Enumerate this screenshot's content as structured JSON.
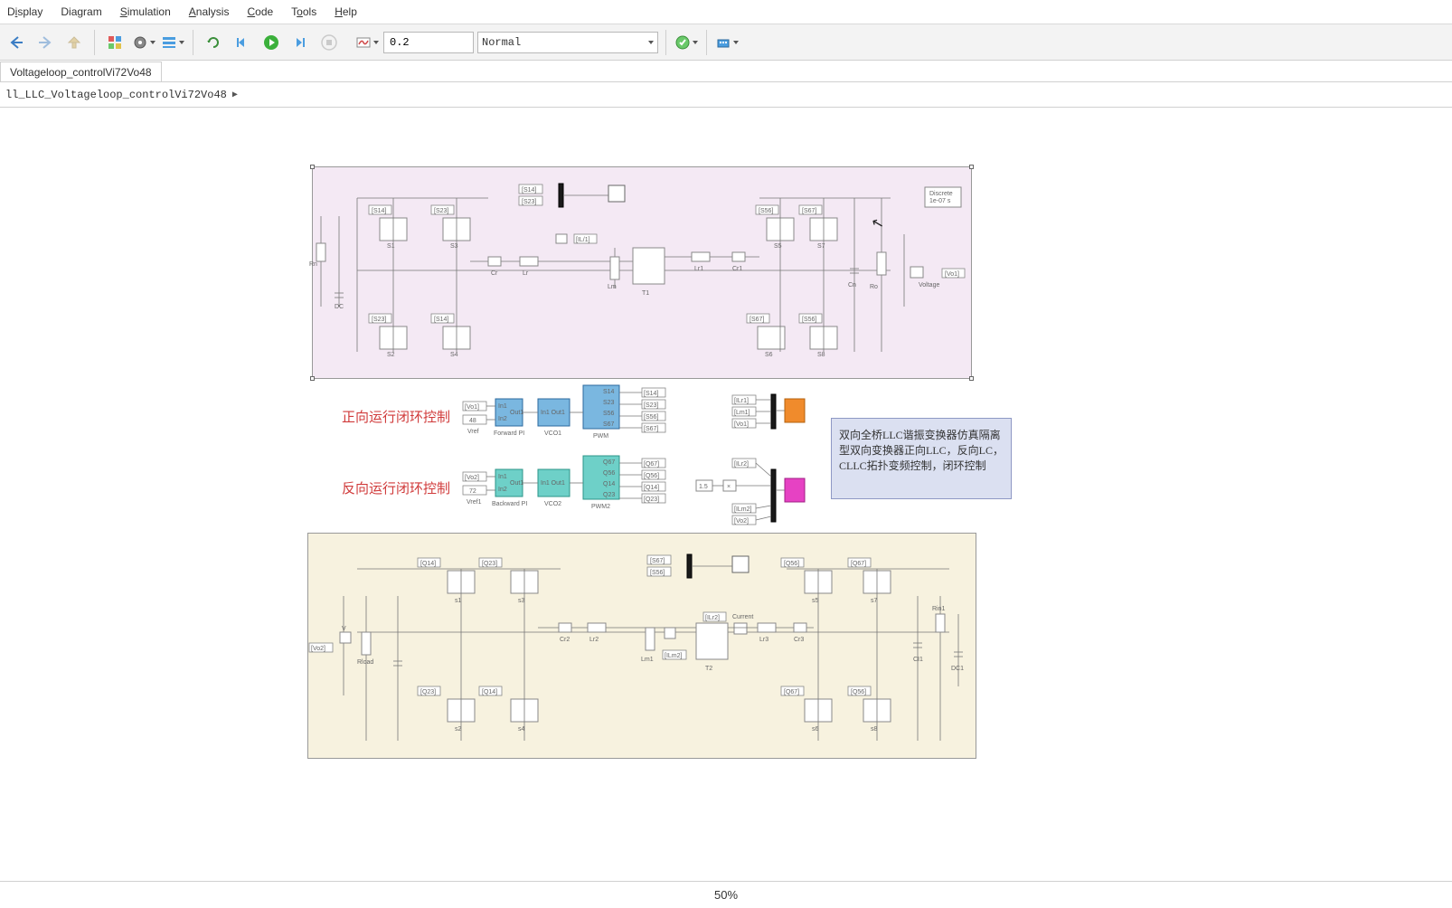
{
  "menu": {
    "display": "Display",
    "diagram": "Diagram",
    "simulation": "Simulation",
    "analysis": "Analysis",
    "code": "Code",
    "tools": "Tools",
    "help": "Help"
  },
  "toolbar": {
    "stop_time": "0.2",
    "sim_mode": "Normal"
  },
  "tabs": {
    "tab1": "Voltageloop_controlVi72Vo48"
  },
  "breadcrumb": {
    "item1": "ll_LLC_Voltageloop_controlVi72Vo48"
  },
  "labels": {
    "forward_control": "正向运行闭环控制",
    "backward_control": "反向运行闭环控制",
    "annotation": "双向全桥LLC谐振变换器仿真隔离型双向变换器正向LLC，反向LC，CLLC拓扑变频控制，闭环控制",
    "discrete": "Discrete\n1e-07 s",
    "zoom": "50%"
  },
  "schematic": {
    "top_tags": [
      "[S14]",
      "[S23]",
      "[S56]",
      "[S67]"
    ],
    "top_tags2": [
      "[S23]",
      "[S14]",
      "[S67]",
      "[S56]"
    ],
    "top_scope_tags": [
      "[S14]",
      "[S23]"
    ],
    "components_top": [
      "S1",
      "S3",
      "S5",
      "S7",
      "S2",
      "S4",
      "S6",
      "S8",
      "Rn",
      "DC",
      "Cr",
      "Lr",
      "Lm",
      "T1",
      "Lr1",
      "Cr1",
      "Cn",
      "Ro",
      "Voltage",
      "[IL/1]",
      "[Vo1]"
    ],
    "fwd_blocks": {
      "in_tags": [
        "[Vo1]",
        "48"
      ],
      "labels": [
        "Vref",
        "Forward PI",
        "VCO1",
        "PWM"
      ],
      "out_tags": [
        "[S14]",
        "[S23]",
        "[S56]",
        "[S67]"
      ],
      "ports": [
        "In1",
        "In2",
        "Out1",
        "S14",
        "S23",
        "S56",
        "S67"
      ]
    },
    "bwd_blocks": {
      "in_tags": [
        "[Vo2]",
        "72"
      ],
      "labels": [
        "Vref1",
        "Backward PI",
        "VCO2",
        "PWM2"
      ],
      "out_tags": [
        "[Q67]",
        "[Q56]",
        "[Q14]",
        "[Q23]"
      ],
      "ports": [
        "In1",
        "In2",
        "Out1",
        "Q67",
        "Q56",
        "Q14",
        "Q23"
      ]
    },
    "scope_right1": {
      "in": [
        "[ILr1]",
        "[Lm1]",
        "[Vo1]"
      ]
    },
    "scope_right2": {
      "in": [
        "[ILr2]",
        "[ILm2]",
        "[Vo2]"
      ],
      "gain": "1.5"
    },
    "bottom_tags": [
      "[Q14]",
      "[Q23]",
      "[Q56]",
      "[Q67]"
    ],
    "bottom_tags2": [
      "[Q23]",
      "[Q14]",
      "[Q67]",
      "[Q56]"
    ],
    "bottom_scope_tags": [
      "[S67]",
      "[S56]"
    ],
    "components_bottom": [
      "s1",
      "s3",
      "s5",
      "s7",
      "s2",
      "s4",
      "s6",
      "s8",
      "Rload",
      "Cr2",
      "Lr2",
      "Lm1",
      "T2",
      "Lr3",
      "Cr3",
      "Cl1",
      "DC1",
      "Rin1",
      "Current",
      "[ILr2]",
      "[ILm2]",
      "[Vo2]",
      "V",
      "current"
    ]
  }
}
